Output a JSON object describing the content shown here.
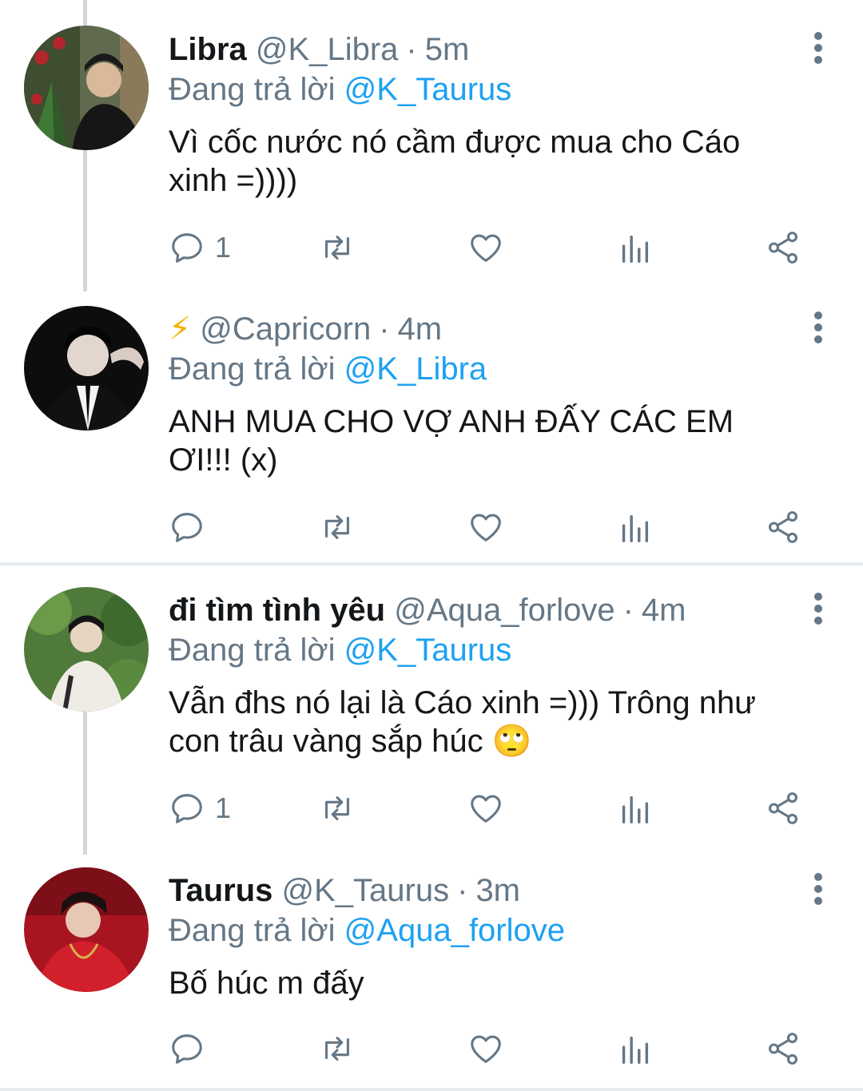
{
  "tweets": [
    {
      "name": "Libra",
      "handle": "@K_Libra",
      "dot": "·",
      "time": "5m",
      "reply_prefix": "Đang trả lời",
      "reply_to": "@K_Taurus",
      "text_lines": [
        "Vì cốc nước nó cầm được mua cho Cáo",
        "xinh =))))"
      ],
      "reply_count": "1"
    },
    {
      "name": "⚡",
      "handle": "@Capricorn",
      "dot": "·",
      "time": "4m",
      "reply_prefix": "Đang trả lời",
      "reply_to": "@K_Libra",
      "text_lines": [
        "ANH MUA CHO VỢ ANH ĐẤY CÁC EM",
        "ƠI!!! (x)"
      ],
      "reply_count": ""
    },
    {
      "name": "đi tìm tình yêu",
      "handle": "@Aqua_forlove",
      "dot": "·",
      "time": "4m",
      "reply_prefix": "Đang trả lời",
      "reply_to": "@K_Taurus",
      "text_lines": [
        "Vẫn đhs nó lại là Cáo xinh =))) Trông như",
        "con trâu vàng sắp húc 🙄"
      ],
      "reply_count": "1"
    },
    {
      "name": "Taurus",
      "handle": "@K_Taurus",
      "dot": "·",
      "time": "3m",
      "reply_prefix": "Đang trả lời",
      "reply_to": "@Aqua_forlove",
      "text_lines": [
        "Bố húc m đấy"
      ],
      "reply_count": ""
    }
  ],
  "colors": {
    "link": "#1da1f2",
    "secondary": "#657786",
    "thread_line": "#d4d8dc",
    "divider": "#e6ecf0"
  },
  "icons": [
    "reply-icon",
    "retweet-icon",
    "like-icon",
    "analytics-icon",
    "share-icon",
    "more-options-icon"
  ]
}
